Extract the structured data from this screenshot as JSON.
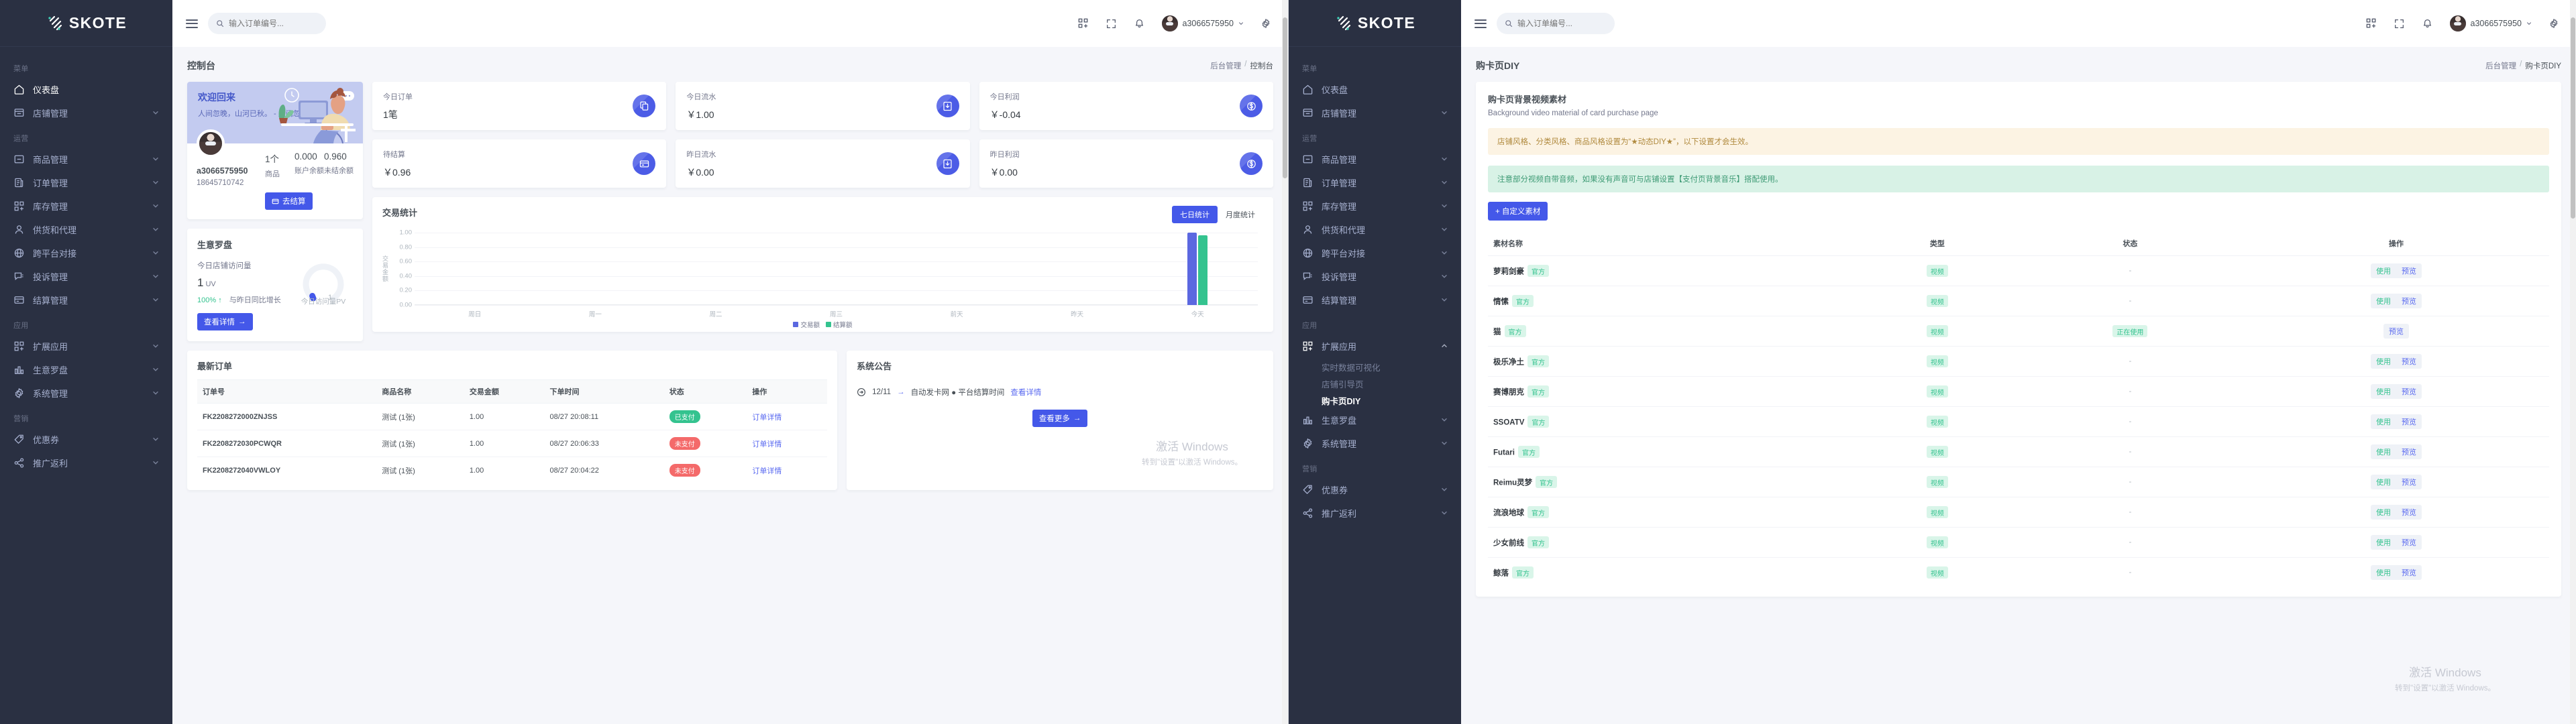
{
  "brand": {
    "name": "SKOTE"
  },
  "topbar": {
    "search_placeholder": "输入订单编号...",
    "user_name": "a3066575950",
    "icons": [
      "apps-icon",
      "fullscreen-icon",
      "bell-icon",
      "gear-icon"
    ]
  },
  "sidebar": {
    "groups": [
      {
        "caption": "菜单",
        "items": [
          {
            "label": "仪表盘",
            "icon": "home-icon",
            "expandable": false,
            "active_left": true
          },
          {
            "label": "店铺管理",
            "icon": "shop-icon",
            "expandable": true
          }
        ]
      },
      {
        "caption": "运营",
        "items": [
          {
            "label": "商品管理",
            "icon": "box-icon",
            "expandable": true
          },
          {
            "label": "订单管理",
            "icon": "order-icon",
            "expandable": true
          },
          {
            "label": "库存管理",
            "icon": "grid-plus-icon",
            "expandable": true
          },
          {
            "label": "供货和代理",
            "icon": "user-icon",
            "expandable": true
          },
          {
            "label": "跨平台对接",
            "icon": "globe-icon",
            "expandable": true
          },
          {
            "label": "投诉管理",
            "icon": "chat-icon",
            "expandable": true
          },
          {
            "label": "结算管理",
            "icon": "card-icon",
            "expandable": true
          }
        ]
      },
      {
        "caption": "应用",
        "items": [
          {
            "label": "扩展应用",
            "icon": "grid-plus-icon",
            "expandable": true,
            "submenu": [
              "实时数据可视化",
              "店铺引导页",
              "购卡页DIY"
            ],
            "active_sub": "购卡页DIY"
          },
          {
            "label": "生意罗盘",
            "icon": "bars-icon",
            "expandable": true
          },
          {
            "label": "系统管理",
            "icon": "gear-icon",
            "expandable": true
          }
        ]
      },
      {
        "caption": "营销",
        "items": [
          {
            "label": "优惠券",
            "icon": "tag-icon",
            "expandable": true
          },
          {
            "label": "推广返利",
            "icon": "share-icon",
            "expandable": true
          }
        ]
      }
    ]
  },
  "dashboard": {
    "title": "控制台",
    "breadcrumb": [
      "后台管理",
      "控制台"
    ],
    "welcome": {
      "heading": "欢迎回来",
      "quote": "人间忽晚，山河已秋。 - 人间忽晚",
      "user_name": "a3066575950",
      "phone": "18645710742",
      "stats": [
        {
          "value": "1个",
          "label": "商品"
        },
        {
          "value": "0.000",
          "label": "账户余额"
        },
        {
          "value": "0.960",
          "label": "未结余额"
        }
      ],
      "button": "去结算"
    },
    "compass": {
      "title": "生意罗盘",
      "sub": "今日店铺访问量",
      "value": "1",
      "unit": "UV",
      "delta": "100%",
      "delta_note": "与昨日同比增长",
      "button": "查看详情",
      "gauge_value": "1",
      "gauge_caption": "今日访问量PV"
    },
    "stats": [
      {
        "label": "今日订单",
        "value": "1笔",
        "icon": "copy-icon"
      },
      {
        "label": "今日流水",
        "value": "￥1.00",
        "icon": "inbox-down-icon"
      },
      {
        "label": "今日利润",
        "value": "￥-0.04",
        "icon": "dollar-icon"
      },
      {
        "label": "待结算",
        "value": "￥0.96",
        "icon": "card-icon"
      },
      {
        "label": "昨日流水",
        "value": "￥0.00",
        "icon": "inbox-down-icon"
      },
      {
        "label": "昨日利润",
        "value": "￥0.00",
        "icon": "dollar-icon"
      }
    ],
    "chart_tabs": {
      "seven": "七日统计",
      "month": "月度统计",
      "selected": "七日统计"
    },
    "orders": {
      "title": "最新订单",
      "columns": [
        "订单号",
        "商品名称",
        "交易金额",
        "下单时间",
        "状态",
        "操作"
      ],
      "rows": [
        {
          "no": "FK2208272000ZNJSS",
          "product": "测试 (1张)",
          "amount": "1.00",
          "time": "08/27 20:08:11",
          "status": "已支付",
          "status_kind": "green",
          "action": "订单详情"
        },
        {
          "no": "FK2208272030PCWQR",
          "product": "测试 (1张)",
          "amount": "1.00",
          "time": "08/27 20:06:33",
          "status": "未支付",
          "status_kind": "red",
          "action": "订单详情"
        },
        {
          "no": "FK2208272040VWLOY",
          "product": "测试 (1张)",
          "amount": "1.00",
          "time": "08/27 20:04:22",
          "status": "未支付",
          "status_kind": "red",
          "action": "订单详情"
        }
      ]
    },
    "notice": {
      "title": "系统公告",
      "date": "12/11",
      "text": "自动发卡网 ● 平台结算时间",
      "link": "查看详情",
      "more": "查看更多"
    },
    "watermark": {
      "line1": "激活 Windows",
      "line2": "转到\"设置\"以激活 Windows。"
    }
  },
  "chart_data": {
    "type": "bar",
    "title": "交易统计",
    "categories": [
      "周日",
      "周一",
      "周二",
      "周三",
      "前天",
      "昨天",
      "今天"
    ],
    "series": [
      {
        "name": "交易额",
        "color": "#5b68e0",
        "values": [
          0,
          0,
          0,
          0,
          0,
          0,
          1.0
        ]
      },
      {
        "name": "结算额",
        "color": "#34c38f",
        "values": [
          0,
          0,
          0,
          0,
          0,
          0,
          0.96
        ]
      }
    ],
    "yticks": [
      "1.00",
      "0.80",
      "0.60",
      "0.40",
      "0.20",
      "0.00"
    ],
    "ylim": [
      0,
      1.0
    ],
    "ylabel": "交易金额",
    "xlabel": "",
    "grid": true,
    "legend_position": "bottom"
  },
  "diy": {
    "title": "购卡页DIY",
    "breadcrumb": [
      "后台管理",
      "购卡页DIY"
    ],
    "heading": "购卡页背景视频素材",
    "subheading": "Background video material of card purchase page",
    "alert_warn": "店铺风格、分类风格、商品风格设置为“★动态DIY★”，以下设置才会生效。",
    "alert_ok": "注意部分视频自带音频，如果没有声音可与店铺设置【支付页背景音乐】搭配使用。",
    "add_button": "+ 自定义素材",
    "columns": [
      "素材名称",
      "类型",
      "状态",
      "操作"
    ],
    "rows": [
      {
        "name": "萝莉剑豪",
        "badge": "官方",
        "type": "视频",
        "status": "-",
        "status_kind": "dash",
        "actions": [
          "使用",
          "预览"
        ]
      },
      {
        "name": "情愫",
        "badge": "官方",
        "type": "视频",
        "status": "-",
        "status_kind": "dash",
        "actions": [
          "使用",
          "预览"
        ]
      },
      {
        "name": "猫",
        "badge": "官方",
        "type": "视频",
        "status": "正在使用",
        "status_kind": "using",
        "actions": [
          "预览"
        ]
      },
      {
        "name": "极乐净土",
        "badge": "官方",
        "type": "视频",
        "status": "-",
        "status_kind": "dash",
        "actions": [
          "使用",
          "预览"
        ]
      },
      {
        "name": "赛博朋克",
        "badge": "官方",
        "type": "视频",
        "status": "-",
        "status_kind": "dash",
        "actions": [
          "使用",
          "预览"
        ]
      },
      {
        "name": "SSOATV",
        "badge": "官方",
        "type": "视频",
        "status": "-",
        "status_kind": "dash",
        "actions": [
          "使用",
          "预览"
        ]
      },
      {
        "name": "Futari",
        "badge": "官方",
        "type": "视频",
        "status": "-",
        "status_kind": "dash",
        "actions": [
          "使用",
          "预览"
        ]
      },
      {
        "name": "Reimu灵梦",
        "badge": "官方",
        "type": "视频",
        "status": "-",
        "status_kind": "dash",
        "actions": [
          "使用",
          "预览"
        ]
      },
      {
        "name": "流浪地球",
        "badge": "官方",
        "type": "视频",
        "status": "-",
        "status_kind": "dash",
        "actions": [
          "使用",
          "预览"
        ]
      },
      {
        "name": "少女前线",
        "badge": "官方",
        "type": "视频",
        "status": "-",
        "status_kind": "dash",
        "actions": [
          "使用",
          "预览"
        ]
      },
      {
        "name": "鲸落",
        "badge": "官方",
        "type": "视频",
        "status": "-",
        "status_kind": "dash",
        "actions": [
          "使用",
          "预览"
        ]
      }
    ],
    "watermark": {
      "line1": "激活 Windows",
      "line2": "转到\"设置\"以激活 Windows。"
    }
  },
  "colors": {
    "accent": "#4458e9",
    "sidebar": "#2a3042",
    "green": "#34c38f",
    "red": "#f46a6a",
    "bg": "#f5f6fa"
  }
}
